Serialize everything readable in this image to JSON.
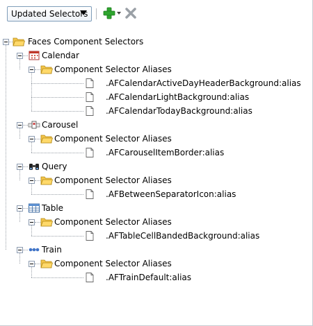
{
  "toolbar": {
    "selector_value": "Updated Selectors",
    "add_icon": "add-icon",
    "delete_icon": "delete-icon"
  },
  "tree": {
    "root": "Faces Component Selectors",
    "groups": [
      {
        "name": "Calendar",
        "icon": "calendar-icon",
        "folder": "Component Selector Aliases",
        "items": [
          ".AFCalendarActiveDayHeaderBackground:alias",
          ".AFCalendarLightBackground:alias",
          ".AFCalendarTodayBackground:alias"
        ]
      },
      {
        "name": "Carousel",
        "icon": "carousel-icon",
        "folder": "Component Selector Aliases",
        "items": [
          ".AFCarouselItemBorder:alias"
        ]
      },
      {
        "name": "Query",
        "icon": "binoculars-icon",
        "folder": "Component Selector Aliases",
        "items": [
          ".AFBetweenSeparatorIcon:alias"
        ]
      },
      {
        "name": "Table",
        "icon": "table-icon",
        "folder": "Component Selector Aliases",
        "items": [
          ".AFTableCellBandedBackground:alias"
        ]
      },
      {
        "name": "Train",
        "icon": "train-icon",
        "folder": "Component Selector Aliases",
        "items": [
          ".AFTrainDefault:alias"
        ]
      }
    ]
  },
  "colors": {
    "folder": "#f3c54a",
    "add": "#2fa52f",
    "delete": "#9aa0a6"
  }
}
